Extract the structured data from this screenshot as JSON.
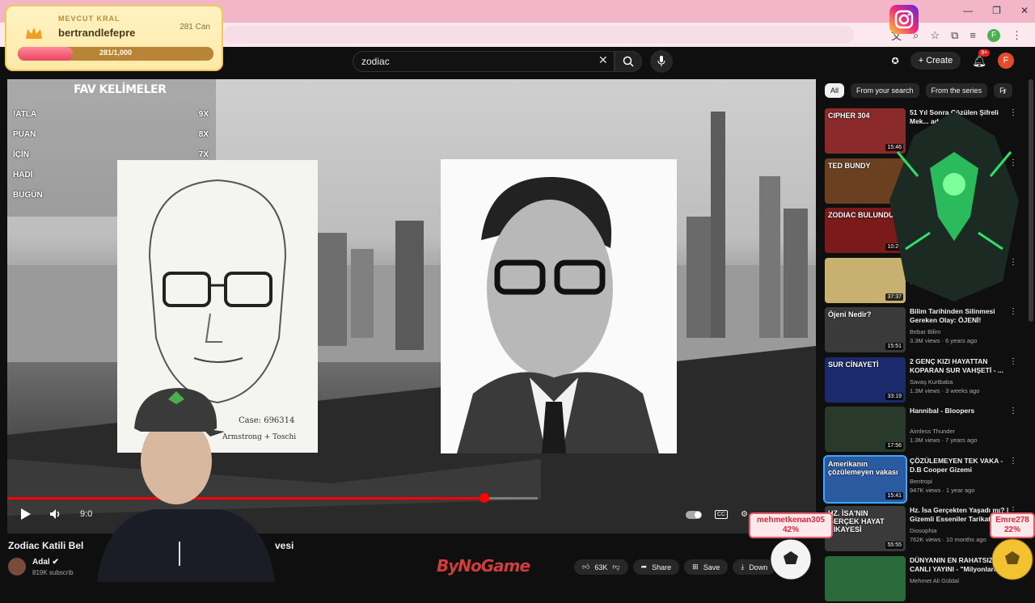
{
  "browser": {
    "window_controls": [
      "—",
      "❐",
      "✕"
    ],
    "profile_initial": "F"
  },
  "header": {
    "search_query": "zodiac",
    "create_label": "Create",
    "notifications_badge": "9+",
    "user_initial": "F"
  },
  "overlay": {
    "king_label": "MEVCUT KRAL",
    "king_name": "bertrandlefepre",
    "king_hp": "281 Can",
    "king_bar_text": "281/1,000",
    "king_bar_fraction": 0.281,
    "vote_left_name": "mehmetkenan305",
    "vote_left_pct": "42%",
    "vote_right_name": "Emre278",
    "vote_right_pct": "22%",
    "watermark": "ByNoGame"
  },
  "fav": {
    "title": "FAV KELİMELER",
    "rows": [
      {
        "word": "!ATLA",
        "count": "9X"
      },
      {
        "word": "PUAN",
        "count": "8X"
      },
      {
        "word": "İÇİN",
        "count": "7X"
      },
      {
        "word": "HADİ",
        "count": "6X"
      },
      {
        "word": "BUGÜN",
        "count": "6X"
      }
    ]
  },
  "player": {
    "time": "9:0",
    "progress_fraction": 0.59,
    "buffer_fraction": 0.656,
    "sketch_signature": "Case: 696314",
    "sketch_signature2": "Armstrong + Toschi"
  },
  "video": {
    "title_start": "Zodiac Katili Bel",
    "title_end": "vesi",
    "channel": "Adal",
    "subscribers": "819K subscrib",
    "likes": "63K",
    "share": "Share",
    "save": "Save",
    "download": "Down"
  },
  "sidebar": {
    "chips": [
      "All",
      "From your search",
      "From the series",
      "Fr"
    ],
    "items": [
      {
        "title": "51 Yıl Sonra Çözülen Şifreli Mek... adeseli",
        "channel": "",
        "meta": "",
        "duration": "15:46",
        "thumb_color": "#8a2a2a",
        "thumb_text": "CIPHER 304"
      },
      {
        "title": "",
        "channel": "",
        "meta": "244K · Oni",
        "duration": "",
        "thumb_color": "#6a4020",
        "thumb_text": "TED BUNDY"
      },
      {
        "title": "Zodi... ndar Bu...",
        "channel": "Adi",
        "meta": "ears a",
        "duration": "10:26",
        "thumb_color": "#7a1a1a",
        "thumb_text": "ZODIAC BULUNDU"
      },
      {
        "title": "The... ation: Is Osa... Lad...",
        "channel": "",
        "meta": "749K views",
        "duration": "37:37",
        "thumb_color": "#c8b070",
        "thumb_text": ""
      },
      {
        "title": "Bilim Tarihinden Silinmesi Gereken Olay: ÖJENİ!",
        "channel": "Bebar Bilim",
        "meta": "3.3M views · 6 years ago",
        "duration": "15:51",
        "thumb_color": "#3a3a3a",
        "thumb_text": "Öjeni Nedir?"
      },
      {
        "title": "2 GENÇ KIZI HAYATTAN KOPARAN SUR VAHŞETİ - ...",
        "channel": "Savaş Kurtbaba",
        "meta": "1.3M views · 3 weeks ago",
        "duration": "33:19",
        "thumb_color": "#1a2a6a",
        "thumb_text": "SUR CİNAYETİ"
      },
      {
        "title": "Hannibal - Bloopers",
        "channel": "Aimless Thunder",
        "meta": "1.3M views · 7 years ago",
        "duration": "17:56",
        "thumb_color": "#2a3a2a",
        "thumb_text": ""
      },
      {
        "title": "ÇÖZÜLEMEYEN TEK VAKA - D.B Cooper Gizemi",
        "channel": "Bentropi",
        "meta": "947K views · 1 year ago",
        "duration": "15:41",
        "thumb_color": "#2a5aa0",
        "thumb_text": "Amerikanın çözülemeyen vakası"
      },
      {
        "title": "Hz. İsa Gerçekten Yaşadı mı? | Gizemli Esseniler Tarikatı",
        "channel": "Diosophia",
        "meta": "762K views · 10 months ago",
        "duration": "55:55",
        "thumb_color": "#3a3a3a",
        "thumb_text": "HZ. İSA'NIN GERÇEK HAYAT HİKAYESİ"
      },
      {
        "title": "DÜNYANIN EN RAHATSIZ E... CANLI YAYINI - \"Milyonlarca...",
        "channel": "Mehmet Ali Güldal",
        "meta": "",
        "duration": "",
        "thumb_color": "#2a6a3a",
        "thumb_text": ""
      }
    ]
  }
}
